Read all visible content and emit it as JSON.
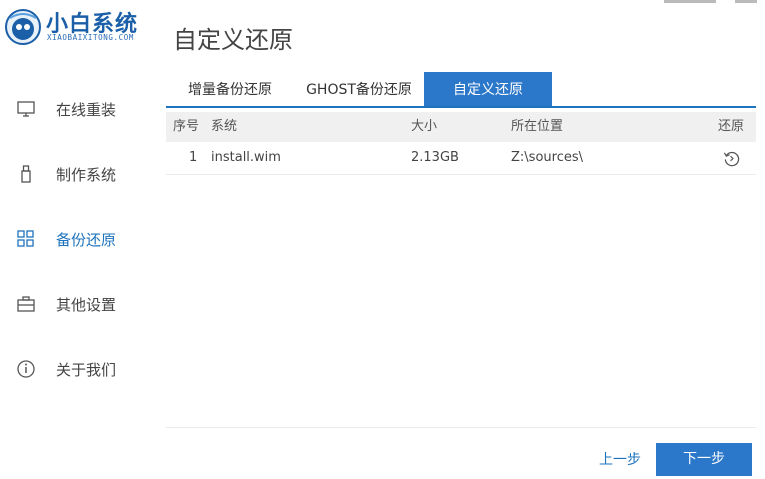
{
  "app": {
    "logo_text": "小白系统",
    "logo_sub": "XIAOBAIXITONG.COM"
  },
  "sidebar": {
    "items": [
      {
        "label": "在线重装",
        "icon": "monitor-icon"
      },
      {
        "label": "制作系统",
        "icon": "usb-icon"
      },
      {
        "label": "备份还原",
        "icon": "grid-icon",
        "active": true
      },
      {
        "label": "其他设置",
        "icon": "toolbox-icon"
      },
      {
        "label": "关于我们",
        "icon": "info-icon"
      }
    ]
  },
  "page": {
    "title": "自定义还原"
  },
  "tabs": [
    {
      "label": "增量备份还原"
    },
    {
      "label": "GHOST备份还原"
    },
    {
      "label": "自定义还原",
      "active": true
    }
  ],
  "table": {
    "headers": [
      "序号",
      "系统",
      "大小",
      "所在位置",
      "还原"
    ],
    "rows": [
      {
        "index": "1",
        "system": "install.wim",
        "size": "2.13GB",
        "location": "Z:\\sources\\",
        "action_icon": "restore-icon"
      }
    ]
  },
  "buttons": {
    "prev": "上一步",
    "next": "下一步"
  },
  "colors": {
    "accent": "#2b77c9",
    "brand": "#1a5fa8"
  }
}
